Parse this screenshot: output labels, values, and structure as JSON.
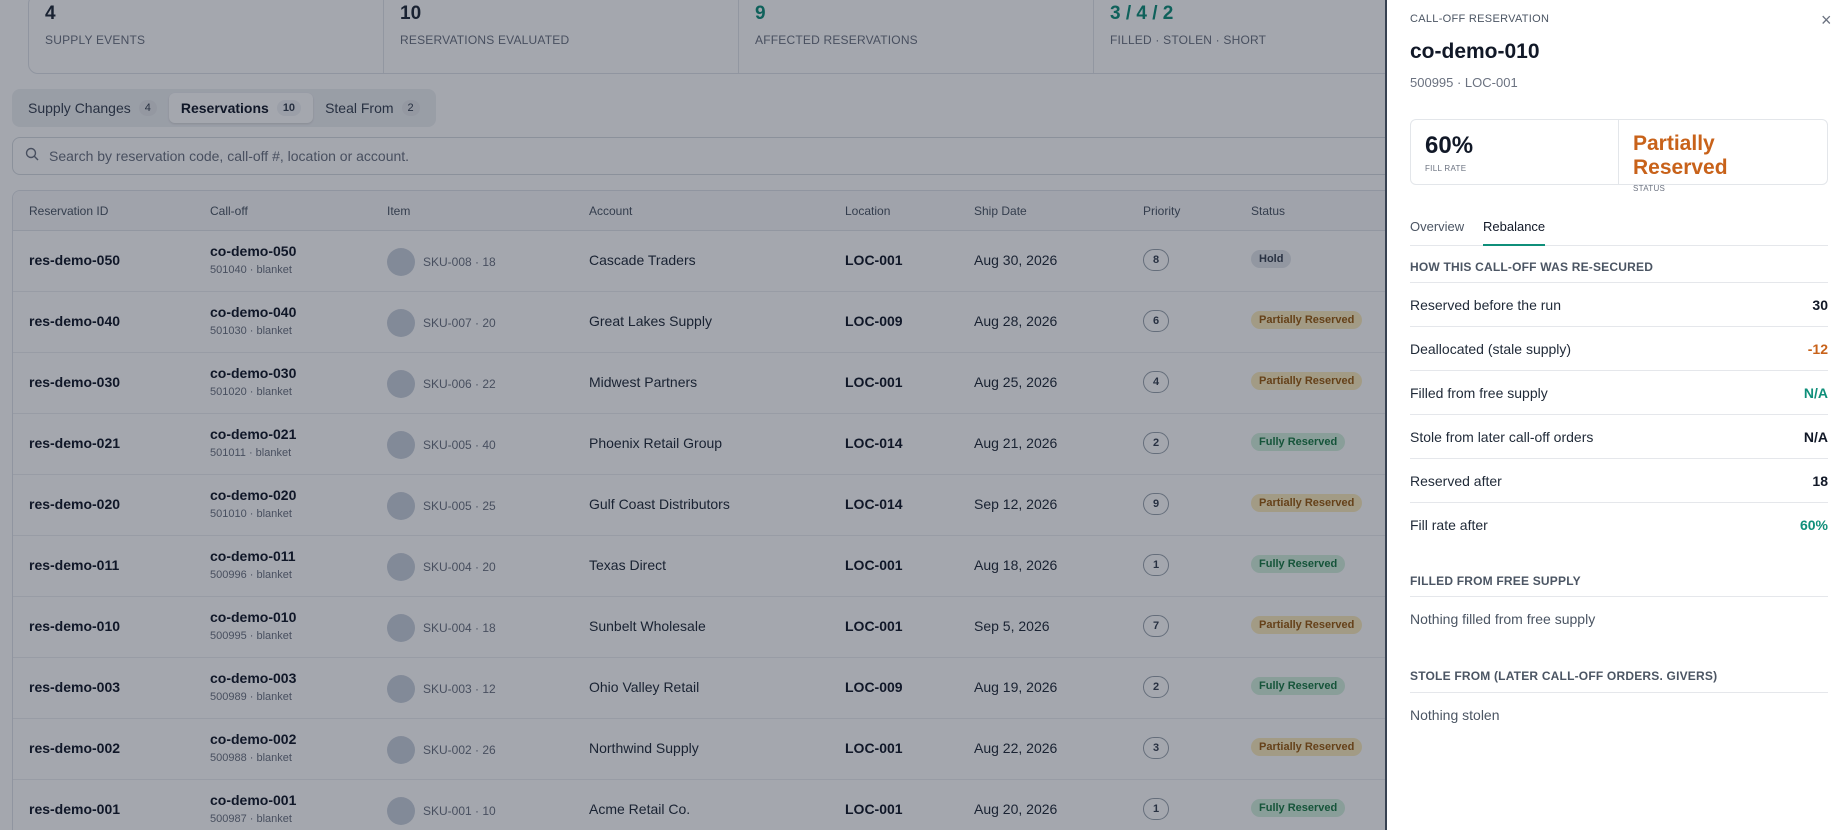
{
  "stats": [
    {
      "value": "4",
      "label": "SUPPLY EVENTS"
    },
    {
      "value": "10",
      "label": "RESERVATIONS EVALUATED"
    },
    {
      "value": "9",
      "label": "AFFECTED RESERVATIONS"
    },
    {
      "value": "3 / 4 / 2",
      "label": "FILLED · STOLEN · SHORT"
    }
  ],
  "tabs": [
    {
      "label": "Supply Changes",
      "count": "4"
    },
    {
      "label": "Reservations",
      "count": "10"
    },
    {
      "label": "Steal From",
      "count": "2"
    }
  ],
  "search": {
    "placeholder": "Search by reservation code, call-off #, location or account."
  },
  "table": {
    "headers": [
      "Reservation ID",
      "Call-off",
      "Item",
      "Account",
      "Location",
      "Ship Date",
      "Priority",
      "Status"
    ],
    "rows": [
      {
        "id": "res-demo-050",
        "calloff": "co-demo-050",
        "calloff_sub": "501040 · blanket",
        "item": "SKU-008 · 18",
        "account": "Cascade Traders",
        "location": "LOC-001",
        "ship_date": "Aug 30, 2026",
        "priority": "8",
        "status": "Hold"
      },
      {
        "id": "res-demo-040",
        "calloff": "co-demo-040",
        "calloff_sub": "501030 · blanket",
        "item": "SKU-007 · 20",
        "account": "Great Lakes Supply",
        "location": "LOC-009",
        "ship_date": "Aug 28, 2026",
        "priority": "6",
        "status": "Partially Reserved"
      },
      {
        "id": "res-demo-030",
        "calloff": "co-demo-030",
        "calloff_sub": "501020 · blanket",
        "item": "SKU-006 · 22",
        "account": "Midwest Partners",
        "location": "LOC-001",
        "ship_date": "Aug 25, 2026",
        "priority": "4",
        "status": "Partially Reserved"
      },
      {
        "id": "res-demo-021",
        "calloff": "co-demo-021",
        "calloff_sub": "501011 · blanket",
        "item": "SKU-005 · 40",
        "account": "Phoenix Retail Group",
        "location": "LOC-014",
        "ship_date": "Aug 21, 2026",
        "priority": "2",
        "status": "Fully Reserved"
      },
      {
        "id": "res-demo-020",
        "calloff": "co-demo-020",
        "calloff_sub": "501010 · blanket",
        "item": "SKU-005 · 25",
        "account": "Gulf Coast Distributors",
        "location": "LOC-014",
        "ship_date": "Sep 12, 2026",
        "priority": "9",
        "status": "Partially Reserved"
      },
      {
        "id": "res-demo-011",
        "calloff": "co-demo-011",
        "calloff_sub": "500996 · blanket",
        "item": "SKU-004 · 20",
        "account": "Texas Direct",
        "location": "LOC-001",
        "ship_date": "Aug 18, 2026",
        "priority": "1",
        "status": "Fully Reserved"
      },
      {
        "id": "res-demo-010",
        "calloff": "co-demo-010",
        "calloff_sub": "500995 · blanket",
        "item": "SKU-004 · 18",
        "account": "Sunbelt Wholesale",
        "location": "LOC-001",
        "ship_date": "Sep 5, 2026",
        "priority": "7",
        "status": "Partially Reserved"
      },
      {
        "id": "res-demo-003",
        "calloff": "co-demo-003",
        "calloff_sub": "500989 · blanket",
        "item": "SKU-003 · 12",
        "account": "Ohio Valley Retail",
        "location": "LOC-009",
        "ship_date": "Aug 19, 2026",
        "priority": "2",
        "status": "Fully Reserved"
      },
      {
        "id": "res-demo-002",
        "calloff": "co-demo-002",
        "calloff_sub": "500988 · blanket",
        "item": "SKU-002 · 26",
        "account": "Northwind Supply",
        "location": "LOC-001",
        "ship_date": "Aug 22, 2026",
        "priority": "3",
        "status": "Partially Reserved"
      },
      {
        "id": "res-demo-001",
        "calloff": "co-demo-001",
        "calloff_sub": "500987 · blanket",
        "item": "SKU-001 · 10",
        "account": "Acme Retail Co.",
        "location": "LOC-001",
        "ship_date": "Aug 20, 2026",
        "priority": "1",
        "status": "Fully Reserved"
      }
    ]
  },
  "drawer": {
    "kicker": "CALL-OFF RESERVATION",
    "close": "×",
    "title": "co-demo-010",
    "subtitle": "500995 · LOC-001",
    "fill_rate": {
      "value": "60%",
      "label": "FILL RATE"
    },
    "status": {
      "value": "Partially Reserved",
      "label": "STATUS"
    },
    "tabs": [
      "Overview",
      "Rebalance"
    ],
    "section1": "HOW THIS CALL-OFF WAS RE-SECURED",
    "rows": [
      {
        "label": "Reserved before the run",
        "value": "30"
      },
      {
        "label": "Deallocated (stale supply)",
        "value": "-12"
      },
      {
        "label": "Filled from free supply",
        "value": "N/A"
      },
      {
        "label": "Stole from later call-off orders",
        "value": "N/A"
      },
      {
        "label": "Reserved after",
        "value": "18"
      },
      {
        "label": "Fill rate after",
        "value": "60%"
      }
    ],
    "section2": "FILLED FROM FREE SUPPLY",
    "empty2": "Nothing filled from free supply",
    "section3": "STOLE FROM (LATER CALL-OFF ORDERS. GIVERS)",
    "empty3": "Nothing stolen"
  },
  "colors": {
    "accent": "#0f8f7a",
    "warning": "#c8621a",
    "overlay": "rgba(15,23,42,0.38)"
  }
}
